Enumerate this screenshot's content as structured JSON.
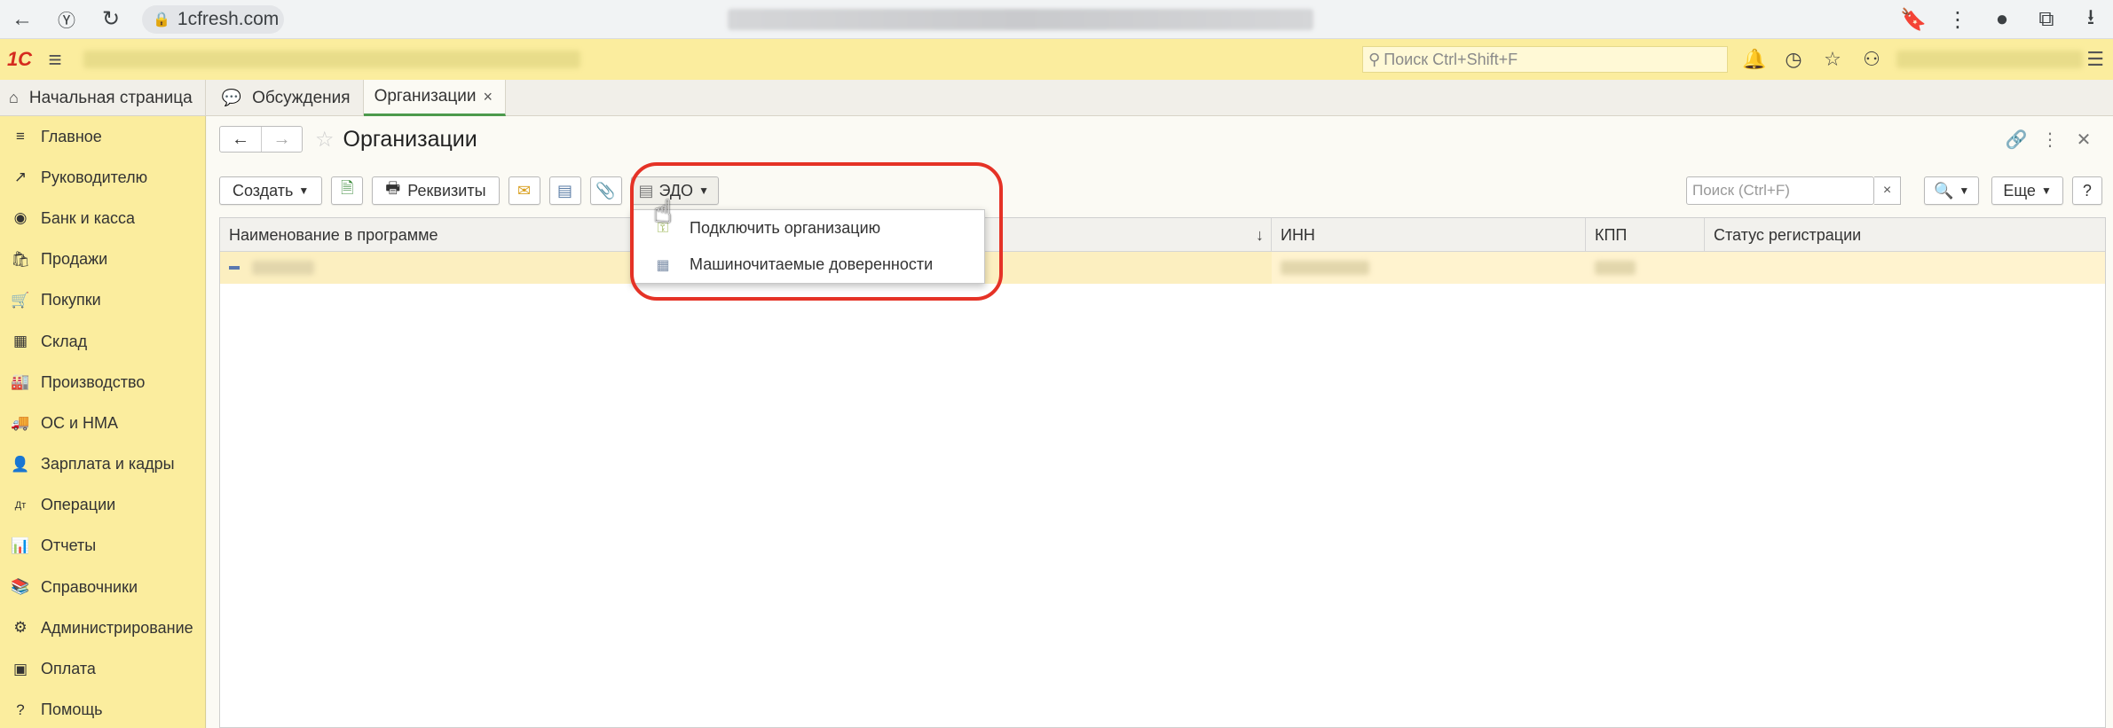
{
  "browser": {
    "url": "1cfresh.com"
  },
  "header": {
    "logo": "1С",
    "search_placeholder": "Поиск Ctrl+Shift+F"
  },
  "tabs": [
    {
      "label": "Начальная страница"
    },
    {
      "label": "Обсуждения"
    },
    {
      "label": "Организации",
      "close": "×"
    }
  ],
  "sidebar": {
    "items": [
      {
        "label": "Главное",
        "icon": "≡"
      },
      {
        "label": "Руководителю",
        "icon": "↗"
      },
      {
        "label": "Банк и касса",
        "icon": "◉"
      },
      {
        "label": "Продажи",
        "icon": "🛍"
      },
      {
        "label": "Покупки",
        "icon": "🛒"
      },
      {
        "label": "Склад",
        "icon": "▦"
      },
      {
        "label": "Производство",
        "icon": "🏭"
      },
      {
        "label": "ОС и НМА",
        "icon": "🚚"
      },
      {
        "label": "Зарплата и кадры",
        "icon": "👤"
      },
      {
        "label": "Операции",
        "icon": "Дт"
      },
      {
        "label": "Отчеты",
        "icon": "📊"
      },
      {
        "label": "Справочники",
        "icon": "📚"
      },
      {
        "label": "Администрирование",
        "icon": "⚙"
      },
      {
        "label": "Оплата",
        "icon": "▣"
      },
      {
        "label": "Помощь",
        "icon": "?"
      }
    ]
  },
  "form": {
    "title": "Организации",
    "toolbar": {
      "create_label": "Создать",
      "requisites_label": "Реквизиты",
      "edo_label": "ЭДО",
      "search_placeholder": "Поиск (Ctrl+F)",
      "clear_label": "×",
      "more_label": "Еще",
      "help_label": "?"
    },
    "table": {
      "columns": [
        "Наименование в программе",
        "ИНН",
        "КПП",
        "Статус регистрации"
      ],
      "sort_indicator": "↓"
    }
  },
  "edo_menu": {
    "items": [
      {
        "label": "Подключить организацию"
      },
      {
        "label": "Машиночитаемые доверенности"
      }
    ]
  },
  "colors": {
    "accent_yellow": "#fbed9e",
    "highlight_red": "#e53226",
    "active_tab_green": "#4c9a4c",
    "logo_red": "#d52b1e"
  }
}
